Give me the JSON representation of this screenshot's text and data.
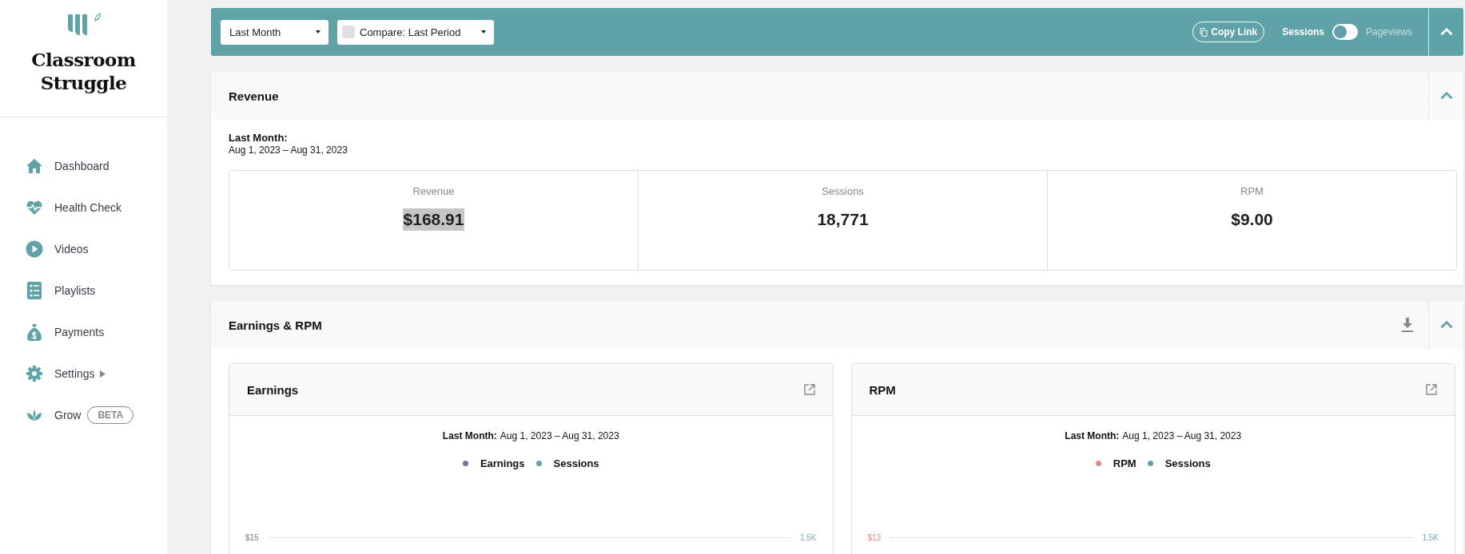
{
  "sidebar": {
    "brand": "Classroom Struggle",
    "items": [
      {
        "label": "Dashboard",
        "has_submenu": false
      },
      {
        "label": "Health Check",
        "has_submenu": false
      },
      {
        "label": "Videos",
        "has_submenu": false
      },
      {
        "label": "Playlists",
        "has_submenu": false
      },
      {
        "label": "Payments",
        "has_submenu": false
      },
      {
        "label": "Settings",
        "has_submenu": true
      },
      {
        "label": "Grow",
        "has_submenu": false,
        "badge": "BETA"
      }
    ]
  },
  "toolbar": {
    "period_select": "Last Month",
    "compare": {
      "label": "Compare: Last Period",
      "checked": false
    },
    "copy_link": "Copy Link",
    "metric_toggle": {
      "left_label": "Sessions",
      "right_label": "Pageviews",
      "on": false
    },
    "expanded": true
  },
  "sections": [
    {
      "kind": "stats",
      "title": "Revenue",
      "expanded": true,
      "period_label": "Last Month:",
      "period_range": "Aug 1, 2023 – Aug 31, 2023",
      "stats": [
        {
          "label": "Revenue",
          "value": "$168.91",
          "highlighted": true
        },
        {
          "label": "Sessions",
          "value": "18,771",
          "highlighted": false
        },
        {
          "label": "RPM",
          "value": "$9.00",
          "highlighted": false
        }
      ]
    },
    {
      "kind": "charts",
      "title": "Earnings & RPM",
      "expanded": true,
      "charts": [
        {
          "title": "Earnings",
          "period_label": "Last Month:",
          "period_range": "Aug 1, 2023 – Aug 31, 2023",
          "legend": [
            {
              "label": "Earnings",
              "color": "#7d6f9e"
            },
            {
              "label": "Sessions",
              "color": "#5fa3a9"
            }
          ],
          "axis_left": "$15",
          "axis_right": "1.5K"
        },
        {
          "title": "RPM",
          "period_label": "Last Month:",
          "period_range": "Aug 1, 2023 – Aug 31, 2023",
          "legend": [
            {
              "label": "RPM",
              "color": "#d9908c"
            },
            {
              "label": "Sessions",
              "color": "#5fa3a9"
            }
          ],
          "axis_left": "$13",
          "axis_right": "1.5K"
        }
      ]
    }
  ]
}
